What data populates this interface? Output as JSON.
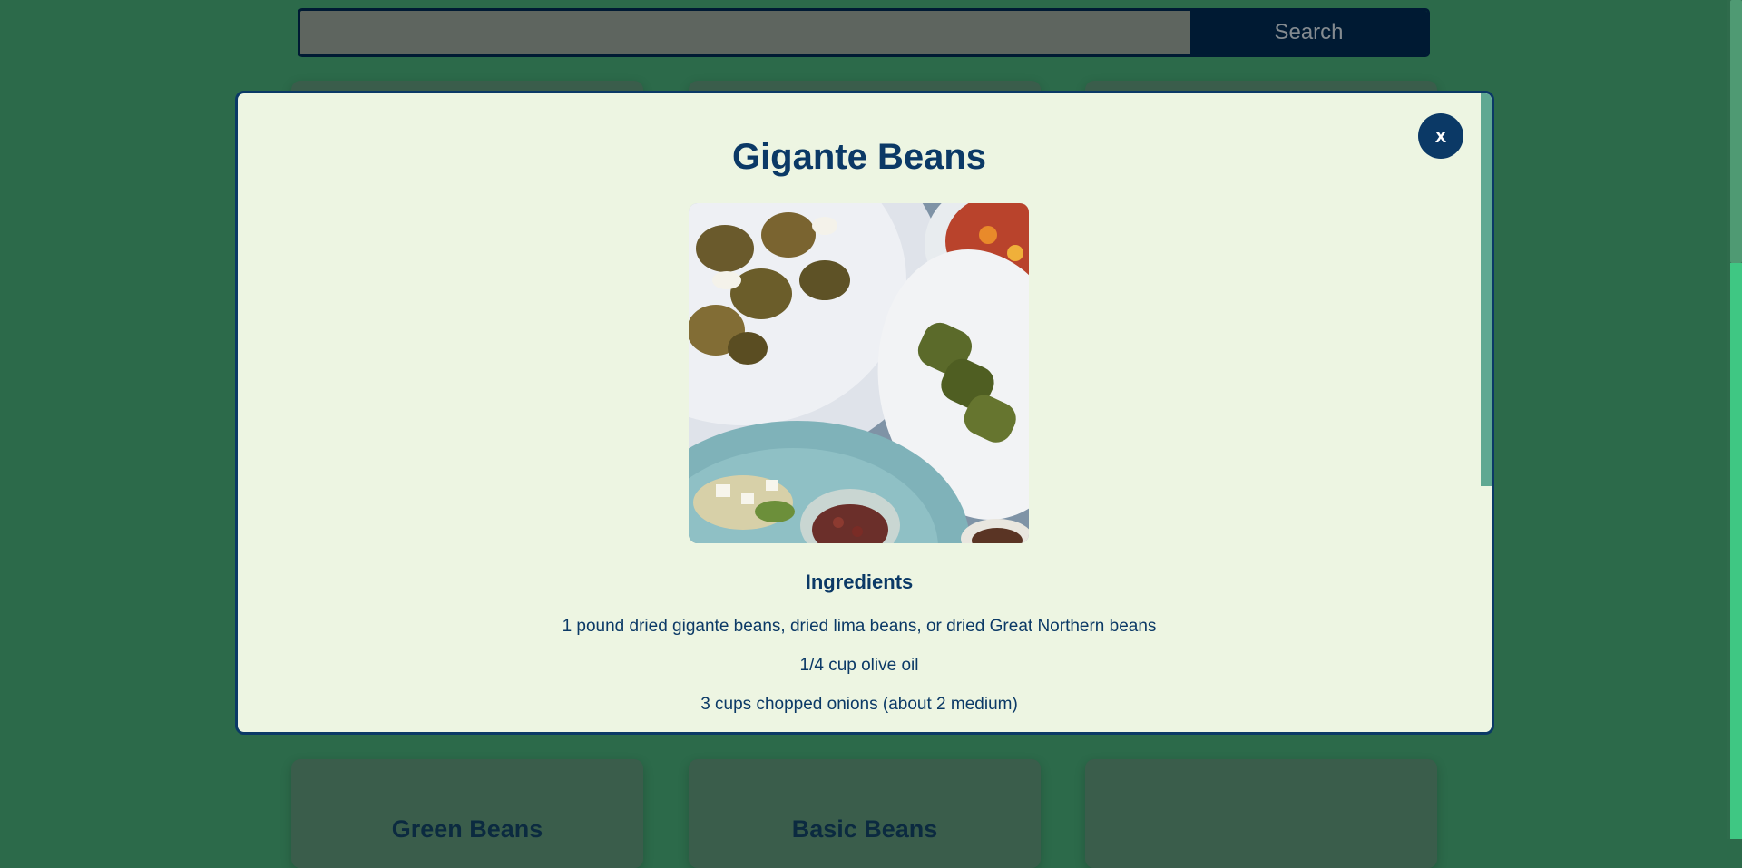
{
  "search": {
    "placeholder": "",
    "value": "",
    "button_label": "Search"
  },
  "cards_top": [
    "",
    "",
    ""
  ],
  "cards_bottom": [
    {
      "title": "Green Beans"
    },
    {
      "title": "Basic Beans"
    },
    {
      "title": ""
    }
  ],
  "modal": {
    "close_label": "x",
    "title": "Gigante Beans",
    "image_alt": "Mezze spread with fritters, stuffed grape leaves, salad and beans",
    "ingredients_heading": "Ingredients",
    "ingredients": [
      "1 pound dried gigante beans, dried lima beans, or dried Great Northern beans",
      "1/4 cup olive oil",
      "3 cups chopped onions (about 2 medium)"
    ]
  },
  "colors": {
    "page_background": "#2c6a4a",
    "modal_background": "#edf5e2",
    "accent_navy": "#0b3966"
  }
}
